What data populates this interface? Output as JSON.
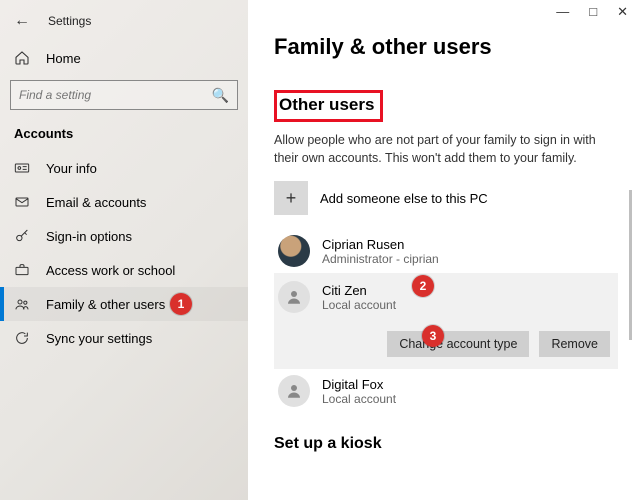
{
  "window": {
    "title": "Settings",
    "home_label": "Home",
    "search_placeholder": "Find a setting",
    "section": "Accounts"
  },
  "sidebar": {
    "items": [
      {
        "label": "Your info"
      },
      {
        "label": "Email & accounts"
      },
      {
        "label": "Sign-in options"
      },
      {
        "label": "Access work or school"
      },
      {
        "label": "Family & other users"
      },
      {
        "label": "Sync your settings"
      }
    ]
  },
  "main": {
    "heading": "Family & other users",
    "section_title": "Other users",
    "description": "Allow people who are not part of your family to sign in with their own accounts. This won't add them to your family.",
    "add_label": "Add someone else to this PC",
    "kiosk_heading": "Set up a kiosk"
  },
  "users": [
    {
      "name": "Ciprian Rusen",
      "subtitle_prefix": "Administrator - ",
      "subtitle_account": "ciprian"
    },
    {
      "name": "Citi Zen",
      "subtitle": "Local account"
    },
    {
      "name": "Digital Fox",
      "subtitle": "Local account"
    }
  ],
  "actions": {
    "change_type": "Change account type",
    "remove": "Remove"
  },
  "badges": {
    "b1": "1",
    "b2": "2",
    "b3": "3"
  }
}
